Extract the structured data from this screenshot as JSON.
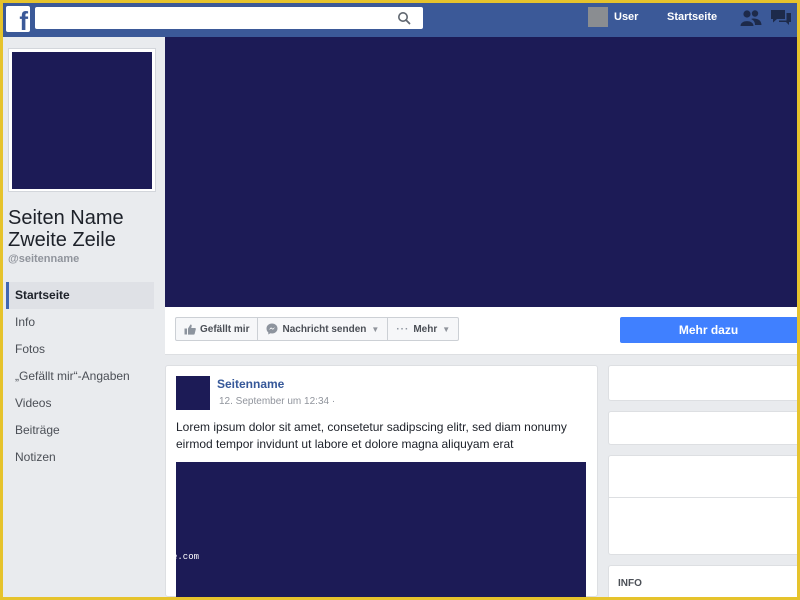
{
  "topbar": {
    "logo_letter": "f",
    "search_placeholder": "",
    "user_label": "User",
    "home_label": "Startseite"
  },
  "sidebar": {
    "page_name_line1": "Seiten Name",
    "page_name_line2": "Zweite Zeile",
    "handle": "@seitenname",
    "items": [
      {
        "label": "Startseite",
        "active": true
      },
      {
        "label": "Info"
      },
      {
        "label": "Fotos"
      },
      {
        "label": "„Gefällt mir“-Angaben"
      },
      {
        "label": "Videos"
      },
      {
        "label": "Beiträge"
      },
      {
        "label": "Notizen"
      }
    ]
  },
  "actions": {
    "like_label": "Gefällt mir",
    "message_label": "Nachricht senden",
    "more_label": "Mehr",
    "cta_label": "Mehr dazu"
  },
  "post": {
    "author": "Seitenname",
    "date": "12. September um 12:34 ·",
    "text": "Lorem ipsum dolor sit amet, consetetur sadipscing elitr, sed diam nonumy eirmod tempor invidunt ut labore et dolore magna aliquyam erat",
    "image_caption": "e.com"
  },
  "right": {
    "info_label": "INFO"
  },
  "colors": {
    "brand": "#3b5998",
    "placeholder": "#1c1b56",
    "cta": "#4080ff",
    "frame": "#e6c32c"
  }
}
